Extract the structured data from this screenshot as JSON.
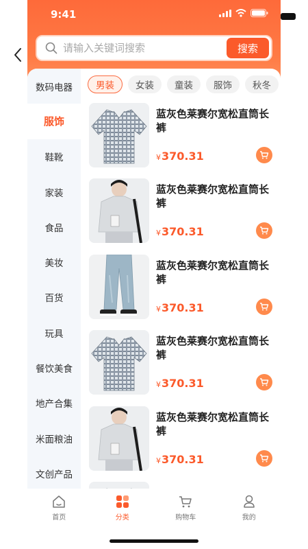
{
  "status": {
    "time": "9:41"
  },
  "search": {
    "placeholder": "请输入关键词搜索",
    "button_label": "搜索"
  },
  "sidebar": {
    "items": [
      {
        "label": "数码电器",
        "active": false
      },
      {
        "label": "服饰",
        "active": true
      },
      {
        "label": "鞋靴",
        "active": false
      },
      {
        "label": "家装",
        "active": false
      },
      {
        "label": "食品",
        "active": false
      },
      {
        "label": "美妆",
        "active": false
      },
      {
        "label": "百货",
        "active": false
      },
      {
        "label": "玩具",
        "active": false
      },
      {
        "label": "餐饮美食",
        "active": false
      },
      {
        "label": "地产合集",
        "active": false
      },
      {
        "label": "米面粮油",
        "active": false
      },
      {
        "label": "文创产品",
        "active": false
      }
    ]
  },
  "chips": [
    {
      "label": "男装",
      "active": true
    },
    {
      "label": "女装",
      "active": false
    },
    {
      "label": "童装",
      "active": false
    },
    {
      "label": "服饰",
      "active": false
    },
    {
      "label": "秋冬",
      "active": false
    }
  ],
  "products": [
    {
      "title": "蓝灰色莱赛尔宽松直筒长裤",
      "currency": "¥",
      "price": "370.31",
      "image": "plaid-shirt"
    },
    {
      "title": "蓝灰色莱赛尔宽松直筒长裤",
      "currency": "¥",
      "price": "370.31",
      "image": "model-shirt"
    },
    {
      "title": "蓝灰色莱赛尔宽松直筒长裤",
      "currency": "¥",
      "price": "370.31",
      "image": "jeans"
    },
    {
      "title": "蓝灰色莱赛尔宽松直筒长裤",
      "currency": "¥",
      "price": "370.31",
      "image": "plaid-shirt"
    },
    {
      "title": "蓝灰色莱赛尔宽松直筒长裤",
      "currency": "¥",
      "price": "370.31",
      "image": "model-shirt"
    },
    {
      "title": "",
      "currency": "",
      "price": "",
      "image": "plaid-shirt"
    }
  ],
  "tabbar": [
    {
      "label": "首页",
      "icon": "home-icon",
      "active": false
    },
    {
      "label": "分类",
      "icon": "category-icon",
      "active": true
    },
    {
      "label": "购物车",
      "icon": "cart-icon",
      "active": false
    },
    {
      "label": "我的",
      "icon": "profile-icon",
      "active": false
    }
  ],
  "colors": {
    "accent": "#fb5a2b",
    "header_gradient_top": "#fe6a3a",
    "sidebar_bg": "#f4f7fb"
  }
}
